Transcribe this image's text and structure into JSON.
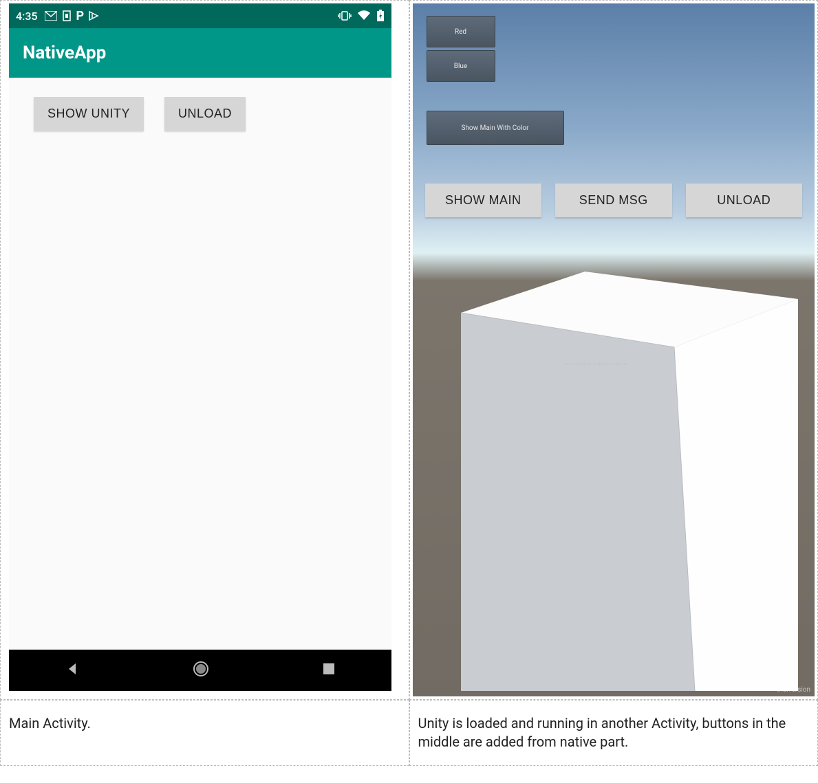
{
  "left": {
    "statusbar": {
      "time": "4:35"
    },
    "appbar": {
      "title": "NativeApp"
    },
    "buttons": {
      "show_unity": "SHOW UNITY",
      "unload": "UNLOAD"
    },
    "caption": "Main Activity."
  },
  "right": {
    "unity_buttons": {
      "red": "Red",
      "blue": "Blue",
      "show_main_color": "Show Main With Color"
    },
    "native_buttons": {
      "show_main": "SHOW MAIN",
      "send_msg": "SEND MSG",
      "unload": "UNLOAD"
    },
    "watermark": "trialversion",
    "caption": "Unity is loaded and running in another Activity, buttons in the middle are added from native part."
  }
}
